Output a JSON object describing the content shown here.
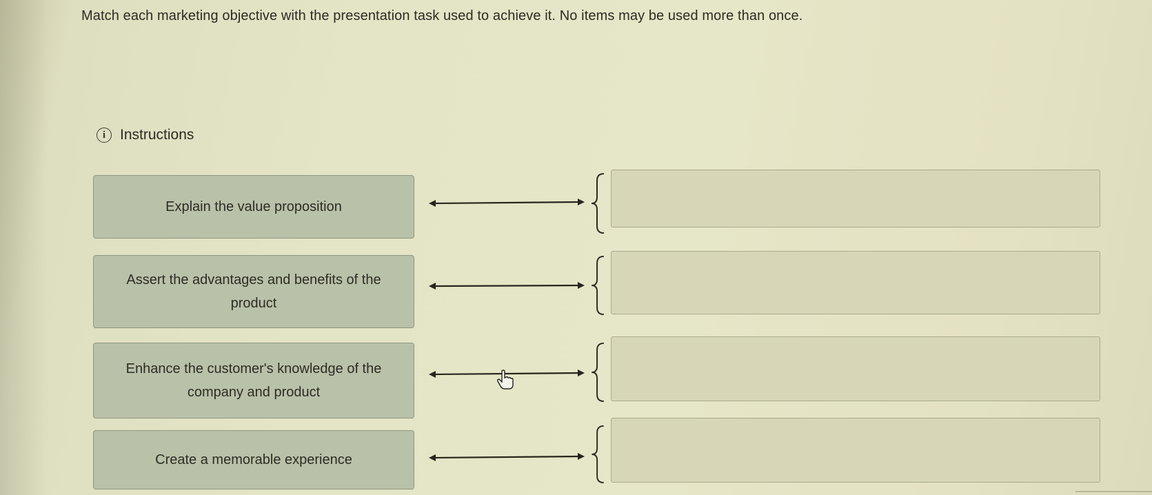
{
  "question": "Match each marketing objective with the presentation task used to achieve it. No items may be used more than once.",
  "instructions_label": "Instructions",
  "pairs": [
    {
      "item": "Explain the value proposition",
      "target": ""
    },
    {
      "item": "Assert the advantages and benefits of the product",
      "target": ""
    },
    {
      "item": "Enhance the customer's knowledge of the company and product",
      "target": ""
    },
    {
      "item": "Create a memorable experience",
      "target": ""
    }
  ],
  "icons": {
    "info": "info-circle-icon",
    "connector": "double-arrow-icon",
    "brace": "left-brace-icon",
    "cursor": "hand-pointer-icon"
  },
  "colors": {
    "background": "#e4e4c6",
    "item_fill": "#b9c1a8",
    "drop_fill": "#d7d7b8",
    "text": "#2b2b24"
  }
}
